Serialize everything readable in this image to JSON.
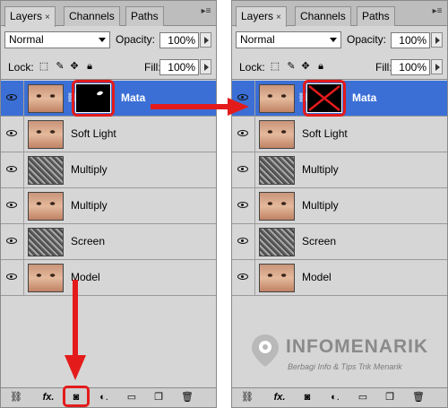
{
  "panels": [
    {
      "tabs": [
        {
          "label": "Layers",
          "close": "×"
        },
        {
          "label": "Channels"
        },
        {
          "label": "Paths"
        }
      ],
      "blend_mode": "Normal",
      "opacity_label": "Opacity:",
      "opacity_value": "100%",
      "lock_label": "Lock:",
      "fill_label": "Fill:",
      "fill_value": "100%",
      "layers": [
        {
          "name": "Mata",
          "selected": true,
          "thumb": "face",
          "has_mask": true
        },
        {
          "name": "Soft Light",
          "thumb": "face"
        },
        {
          "name": "Multiply",
          "thumb": "texture"
        },
        {
          "name": "Multiply",
          "thumb": "face"
        },
        {
          "name": "Screen",
          "thumb": "texture"
        },
        {
          "name": "Model",
          "thumb": "face"
        }
      ],
      "bottom_icons": [
        "link-icon",
        "fx-icon",
        "add-mask-icon",
        "adjustment-icon",
        "folder-icon",
        "new-layer-icon",
        "trash-icon"
      ]
    },
    {
      "tabs": [
        {
          "label": "Layers",
          "close": "×"
        },
        {
          "label": "Channels"
        },
        {
          "label": "Paths"
        }
      ],
      "blend_mode": "Normal",
      "opacity_label": "Opacity:",
      "opacity_value": "100%",
      "lock_label": "Lock:",
      "fill_label": "Fill:",
      "fill_value": "100%",
      "layers": [
        {
          "name": "Mata",
          "selected": true,
          "thumb": "face",
          "has_mask": true,
          "mask_crossed": true
        },
        {
          "name": "Soft Light",
          "thumb": "face"
        },
        {
          "name": "Multiply",
          "thumb": "texture"
        },
        {
          "name": "Multiply",
          "thumb": "face"
        },
        {
          "name": "Screen",
          "thumb": "texture"
        },
        {
          "name": "Model",
          "thumb": "face"
        }
      ],
      "bottom_icons": [
        "link-icon",
        "fx-icon",
        "add-mask-icon",
        "adjustment-icon",
        "folder-icon",
        "new-layer-icon",
        "trash-icon"
      ]
    }
  ],
  "watermark": {
    "title": "INFOMENARIK",
    "tagline": "Berbagi Info & Tips Trik Menarik"
  },
  "colors": {
    "selected_layer": "#3b6fd6",
    "highlight": "#e41b1b",
    "panel_bg": "#d6d6d6"
  }
}
